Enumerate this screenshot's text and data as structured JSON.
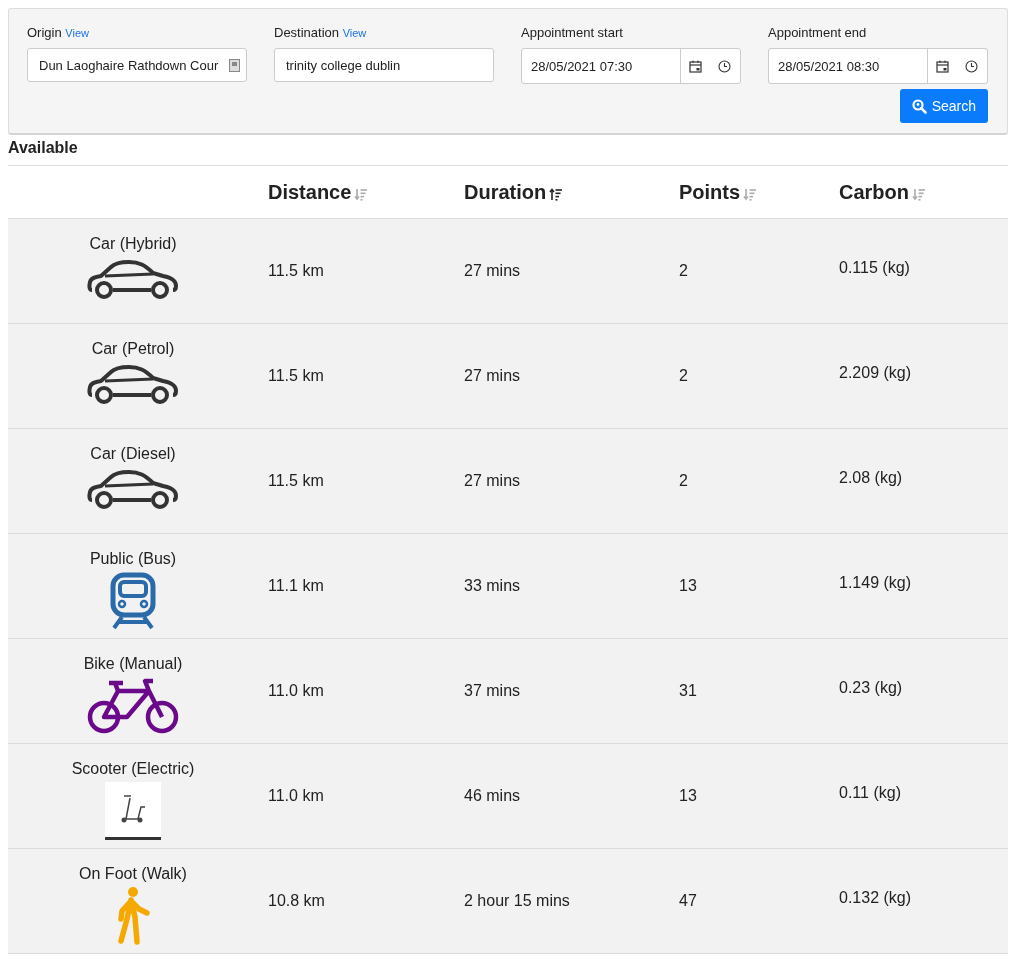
{
  "search_form": {
    "origin": {
      "label": "Origin",
      "link": "View",
      "value": "Dun Laoghaire Rathdown Cour"
    },
    "destination": {
      "label": "Destination",
      "link": "View",
      "value": "trinity college dublin"
    },
    "appointment_start": {
      "label": "Appointment start",
      "value": "28/05/2021 07:30"
    },
    "appointment_end": {
      "label": "Appointment end",
      "value": "28/05/2021 08:30"
    },
    "search_button": "Search"
  },
  "section_title": "Available",
  "table": {
    "columns": [
      {
        "label": "Distance",
        "active": false
      },
      {
        "label": "Duration",
        "active": true
      },
      {
        "label": "Points",
        "active": false
      },
      {
        "label": "Carbon",
        "active": false
      }
    ],
    "rows": [
      {
        "mode": "Car (Hybrid)",
        "kind": "car",
        "distance": "11.5 km",
        "duration": "27 mins",
        "points": "2",
        "carbon": "0.115 (kg)"
      },
      {
        "mode": "Car (Petrol)",
        "kind": "car",
        "distance": "11.5 km",
        "duration": "27 mins",
        "points": "2",
        "carbon": "2.209 (kg)"
      },
      {
        "mode": "Car (Diesel)",
        "kind": "car",
        "distance": "11.5 km",
        "duration": "27 mins",
        "points": "2",
        "carbon": "2.08 (kg)"
      },
      {
        "mode": "Public (Bus)",
        "kind": "train",
        "distance": "11.1 km",
        "duration": "33 mins",
        "points": "13",
        "carbon": "1.149 (kg)"
      },
      {
        "mode": "Bike (Manual)",
        "kind": "bike",
        "distance": "11.0 km",
        "duration": "37 mins",
        "points": "31",
        "carbon": "0.23 (kg)"
      },
      {
        "mode": "Scooter (Electric)",
        "kind": "scooter",
        "distance": "11.0 km",
        "duration": "46 mins",
        "points": "13",
        "carbon": "0.11 (kg)"
      },
      {
        "mode": "On Foot (Walk)",
        "kind": "walk",
        "distance": "10.8 km",
        "duration": "2 hour 15 mins",
        "points": "47",
        "carbon": "0.132 (kg)"
      }
    ]
  }
}
